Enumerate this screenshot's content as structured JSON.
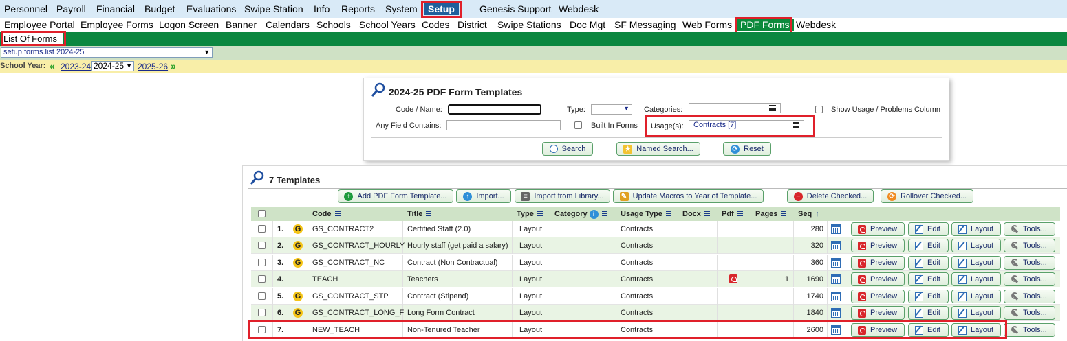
{
  "top_menu": [
    {
      "label": "Personnel"
    },
    {
      "label": "Payroll"
    },
    {
      "label": "Financial"
    },
    {
      "label": "Budget"
    },
    {
      "label": "Evaluations"
    },
    {
      "label": "Swipe Station"
    },
    {
      "label": "Info"
    },
    {
      "label": "Reports"
    },
    {
      "label": "System"
    },
    {
      "label": "Setup"
    },
    {
      "label": "Genesis Support"
    },
    {
      "label": "Webdesk"
    }
  ],
  "sub_menu": [
    {
      "label": "Employee Portal"
    },
    {
      "label": "Employee Forms"
    },
    {
      "label": "Logon Screen"
    },
    {
      "label": "Banner"
    },
    {
      "label": "Calendars"
    },
    {
      "label": "Schools"
    },
    {
      "label": "School Years"
    },
    {
      "label": "Codes"
    },
    {
      "label": "District"
    },
    {
      "label": "Swipe Stations"
    },
    {
      "label": "Doc Mgt"
    },
    {
      "label": "SF Messaging"
    },
    {
      "label": "Web Forms"
    },
    {
      "label": "PDF Forms"
    },
    {
      "label": "Webdesk"
    }
  ],
  "sub_tab": "List Of Forms",
  "screen_select": "setup.forms.list 2024-25",
  "school_year": {
    "label": "School Year:",
    "prev": "2023-24",
    "current": "2024-25",
    "next": "2025-26"
  },
  "search_panel": {
    "title": "2024-25 PDF Form Templates",
    "code_name_label": "Code / Name:",
    "code_name_value": "",
    "type_label": "Type:",
    "type_value": "",
    "categories_label": "Categories:",
    "categories_value": "",
    "show_usage_label": "Show Usage / Problems Column",
    "any_field_label": "Any Field Contains:",
    "any_field_value": "",
    "built_in_label": "Built In Forms",
    "usage_label": "Usage(s):",
    "usage_value": "Contracts [7]",
    "search_btn": "Search",
    "named_search_btn": "Named Search...",
    "reset_btn": "Reset"
  },
  "templates_panel": {
    "title": "7 Templates",
    "add_btn": "Add PDF Form Template...",
    "import_btn": "Import...",
    "import_library_btn": "Import from Library...",
    "update_macros_btn": "Update Macros to Year of Template...",
    "delete_btn": "Delete Checked...",
    "rollover_btn": "Rollover Checked..."
  },
  "columns": {
    "code": "Code",
    "title": "Title",
    "type": "Type",
    "category": "Category",
    "usage": "Usage Type",
    "docx": "Docx",
    "pdf": "Pdf",
    "pages": "Pages",
    "seq": "Seq"
  },
  "row_buttons": {
    "preview": "Preview",
    "edit": "Edit",
    "layout": "Layout",
    "tools": "Tools..."
  },
  "rows": [
    {
      "num": "1.",
      "genesis": true,
      "code": "GS_CONTRACT2",
      "title": "Certified Staff (2.0)",
      "type": "Layout",
      "category": "",
      "usage": "Contracts",
      "docx": "",
      "pdf": false,
      "pages": "",
      "seq": "280"
    },
    {
      "num": "2.",
      "genesis": true,
      "code": "GS_CONTRACT_HOURLY",
      "title": "Hourly staff (get paid a salary)",
      "type": "Layout",
      "category": "",
      "usage": "Contracts",
      "docx": "",
      "pdf": false,
      "pages": "",
      "seq": "320"
    },
    {
      "num": "3.",
      "genesis": true,
      "code": "GS_CONTRACT_NC",
      "title": "Contract (Non Contractual)",
      "type": "Layout",
      "category": "",
      "usage": "Contracts",
      "docx": "",
      "pdf": false,
      "pages": "",
      "seq": "360"
    },
    {
      "num": "4.",
      "genesis": false,
      "code": "TEACH",
      "title": "Teachers",
      "type": "Layout",
      "category": "",
      "usage": "Contracts",
      "docx": "",
      "pdf": true,
      "pages": "1",
      "seq": "1690"
    },
    {
      "num": "5.",
      "genesis": true,
      "code": "GS_CONTRACT_STP",
      "title": "Contract (Stipend)",
      "type": "Layout",
      "category": "",
      "usage": "Contracts",
      "docx": "",
      "pdf": false,
      "pages": "",
      "seq": "1740"
    },
    {
      "num": "6.",
      "genesis": true,
      "code": "GS_CONTRACT_LONG_F",
      "title": "Long Form Contract",
      "type": "Layout",
      "category": "",
      "usage": "Contracts",
      "docx": "",
      "pdf": false,
      "pages": "",
      "seq": "1840"
    },
    {
      "num": "7.",
      "genesis": false,
      "code": "NEW_TEACH",
      "title": "Non-Tenured Teacher",
      "type": "Layout",
      "category": "",
      "usage": "Contracts",
      "docx": "",
      "pdf": false,
      "pages": "",
      "seq": "2600"
    }
  ],
  "genesis_glyph": "G",
  "colors": {
    "highlight": "#e0202a",
    "green_bar": "#0b8740",
    "setup_tab": "#1f5f9b"
  }
}
